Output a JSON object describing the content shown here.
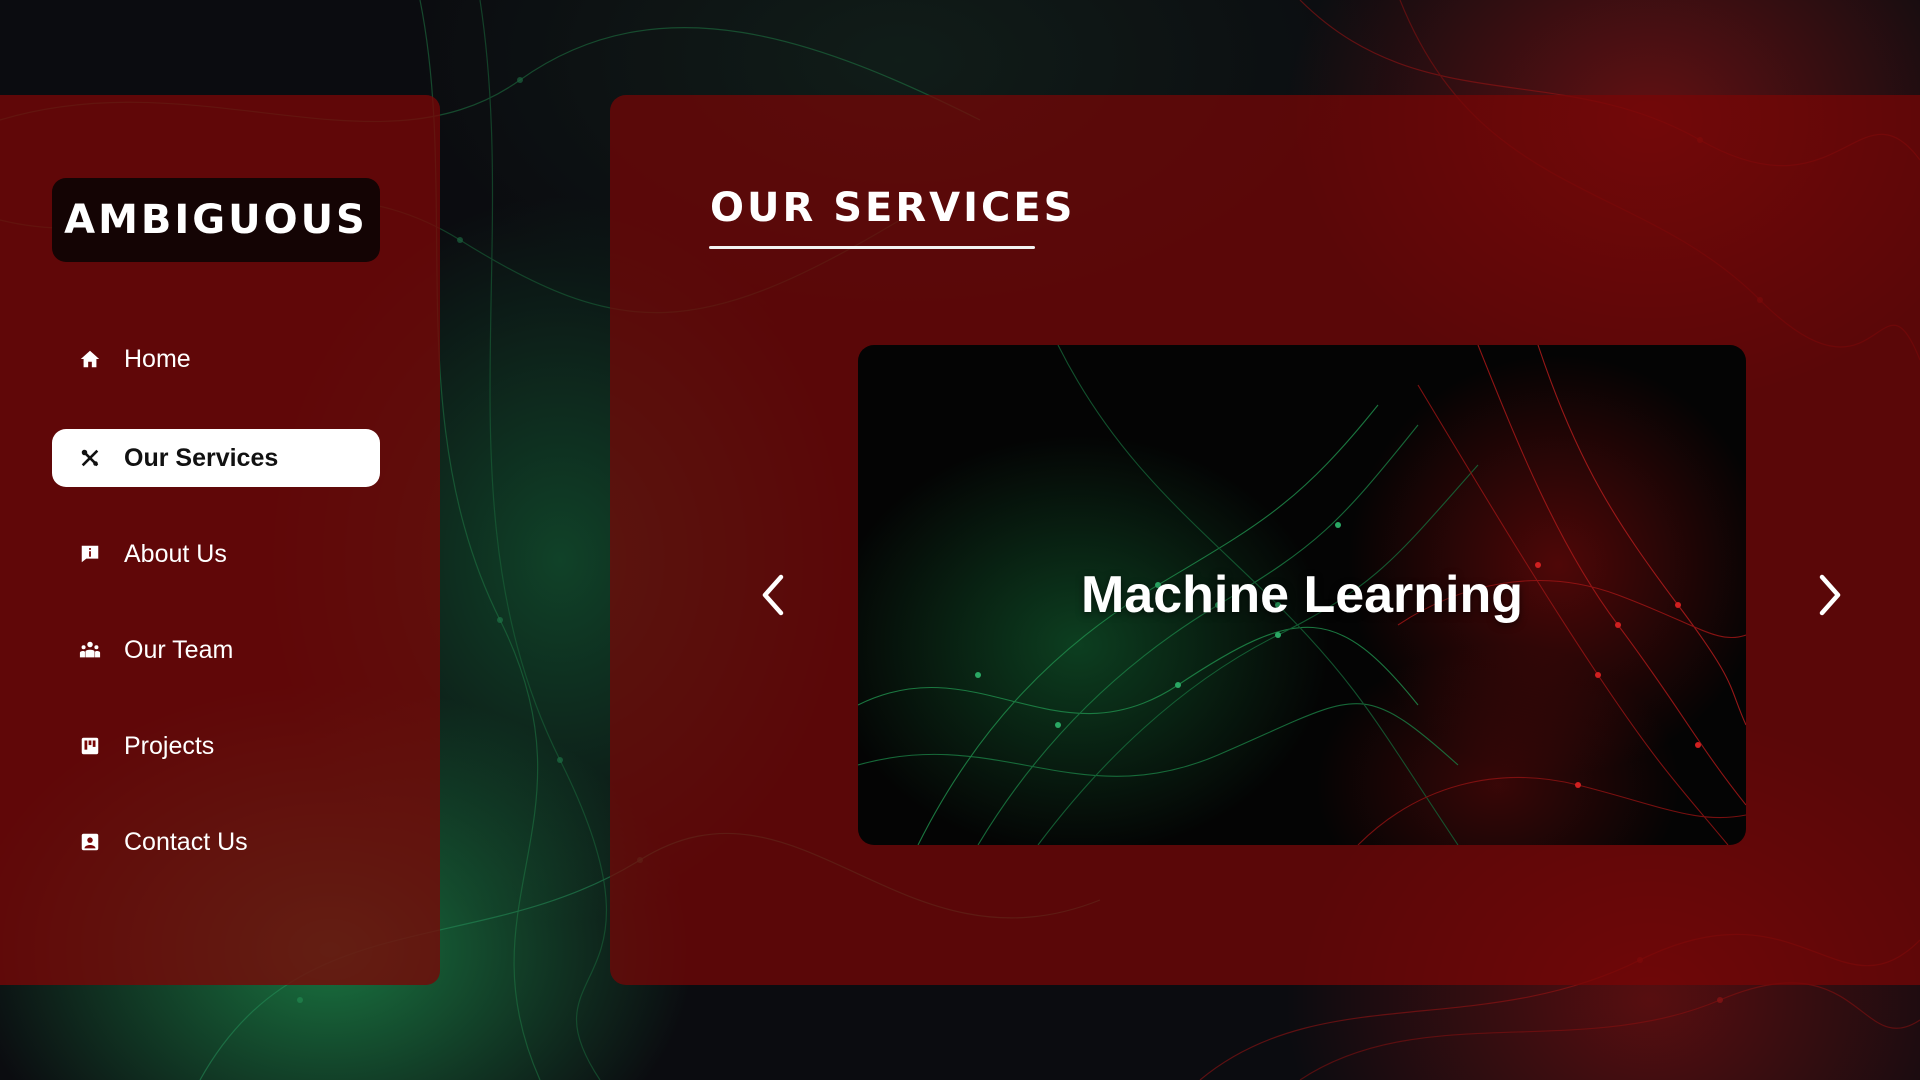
{
  "brand": {
    "logo_text": "AMBIGUOUS"
  },
  "sidebar": {
    "items": [
      {
        "label": "Home",
        "icon": "home-icon",
        "active": false
      },
      {
        "label": "Our Services",
        "icon": "tools-icon",
        "active": true
      },
      {
        "label": "About Us",
        "icon": "info-icon",
        "active": false
      },
      {
        "label": "Our Team",
        "icon": "team-icon",
        "active": false
      },
      {
        "label": "Projects",
        "icon": "projects-icon",
        "active": false
      },
      {
        "label": "Contact Us",
        "icon": "contact-icon",
        "active": false
      }
    ]
  },
  "main": {
    "section_title": "OUR SERVICES",
    "carousel": {
      "current_slide_title": "Machine Learning",
      "prev_icon": "chevron-left-icon",
      "next_icon": "chevron-right-icon"
    }
  },
  "colors": {
    "panel_red": "#780606",
    "active_item_bg": "#ffffff",
    "logo_bg": "#140404",
    "text": "#ffffff"
  }
}
